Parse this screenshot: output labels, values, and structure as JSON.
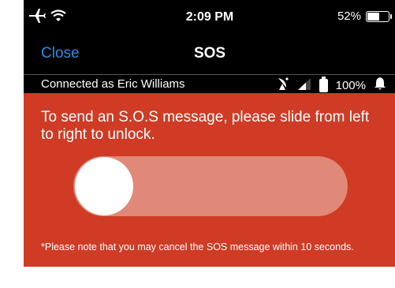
{
  "status_bar": {
    "time": "2:09 PM",
    "battery_percent": "52%",
    "battery_level": 0.52,
    "icons": [
      "airplane-icon",
      "wifi-icon",
      "battery-icon"
    ]
  },
  "nav": {
    "close_label": "Close",
    "title": "SOS"
  },
  "connection": {
    "text": "Connected as Eric Williams",
    "battery_percent": "100%",
    "icons": [
      "satellite-dish-icon",
      "signal-icon",
      "battery-icon",
      "bell-icon"
    ]
  },
  "sos": {
    "instruction": "To send an S.O.S message, please slide from left to right to unlock.",
    "slider_position": 0,
    "note": "*Please note that you may cancel the SOS message within 10 seconds."
  },
  "colors": {
    "panel_red": "#cf3b24",
    "track": "#e08978",
    "link_blue": "#2f8be6"
  }
}
